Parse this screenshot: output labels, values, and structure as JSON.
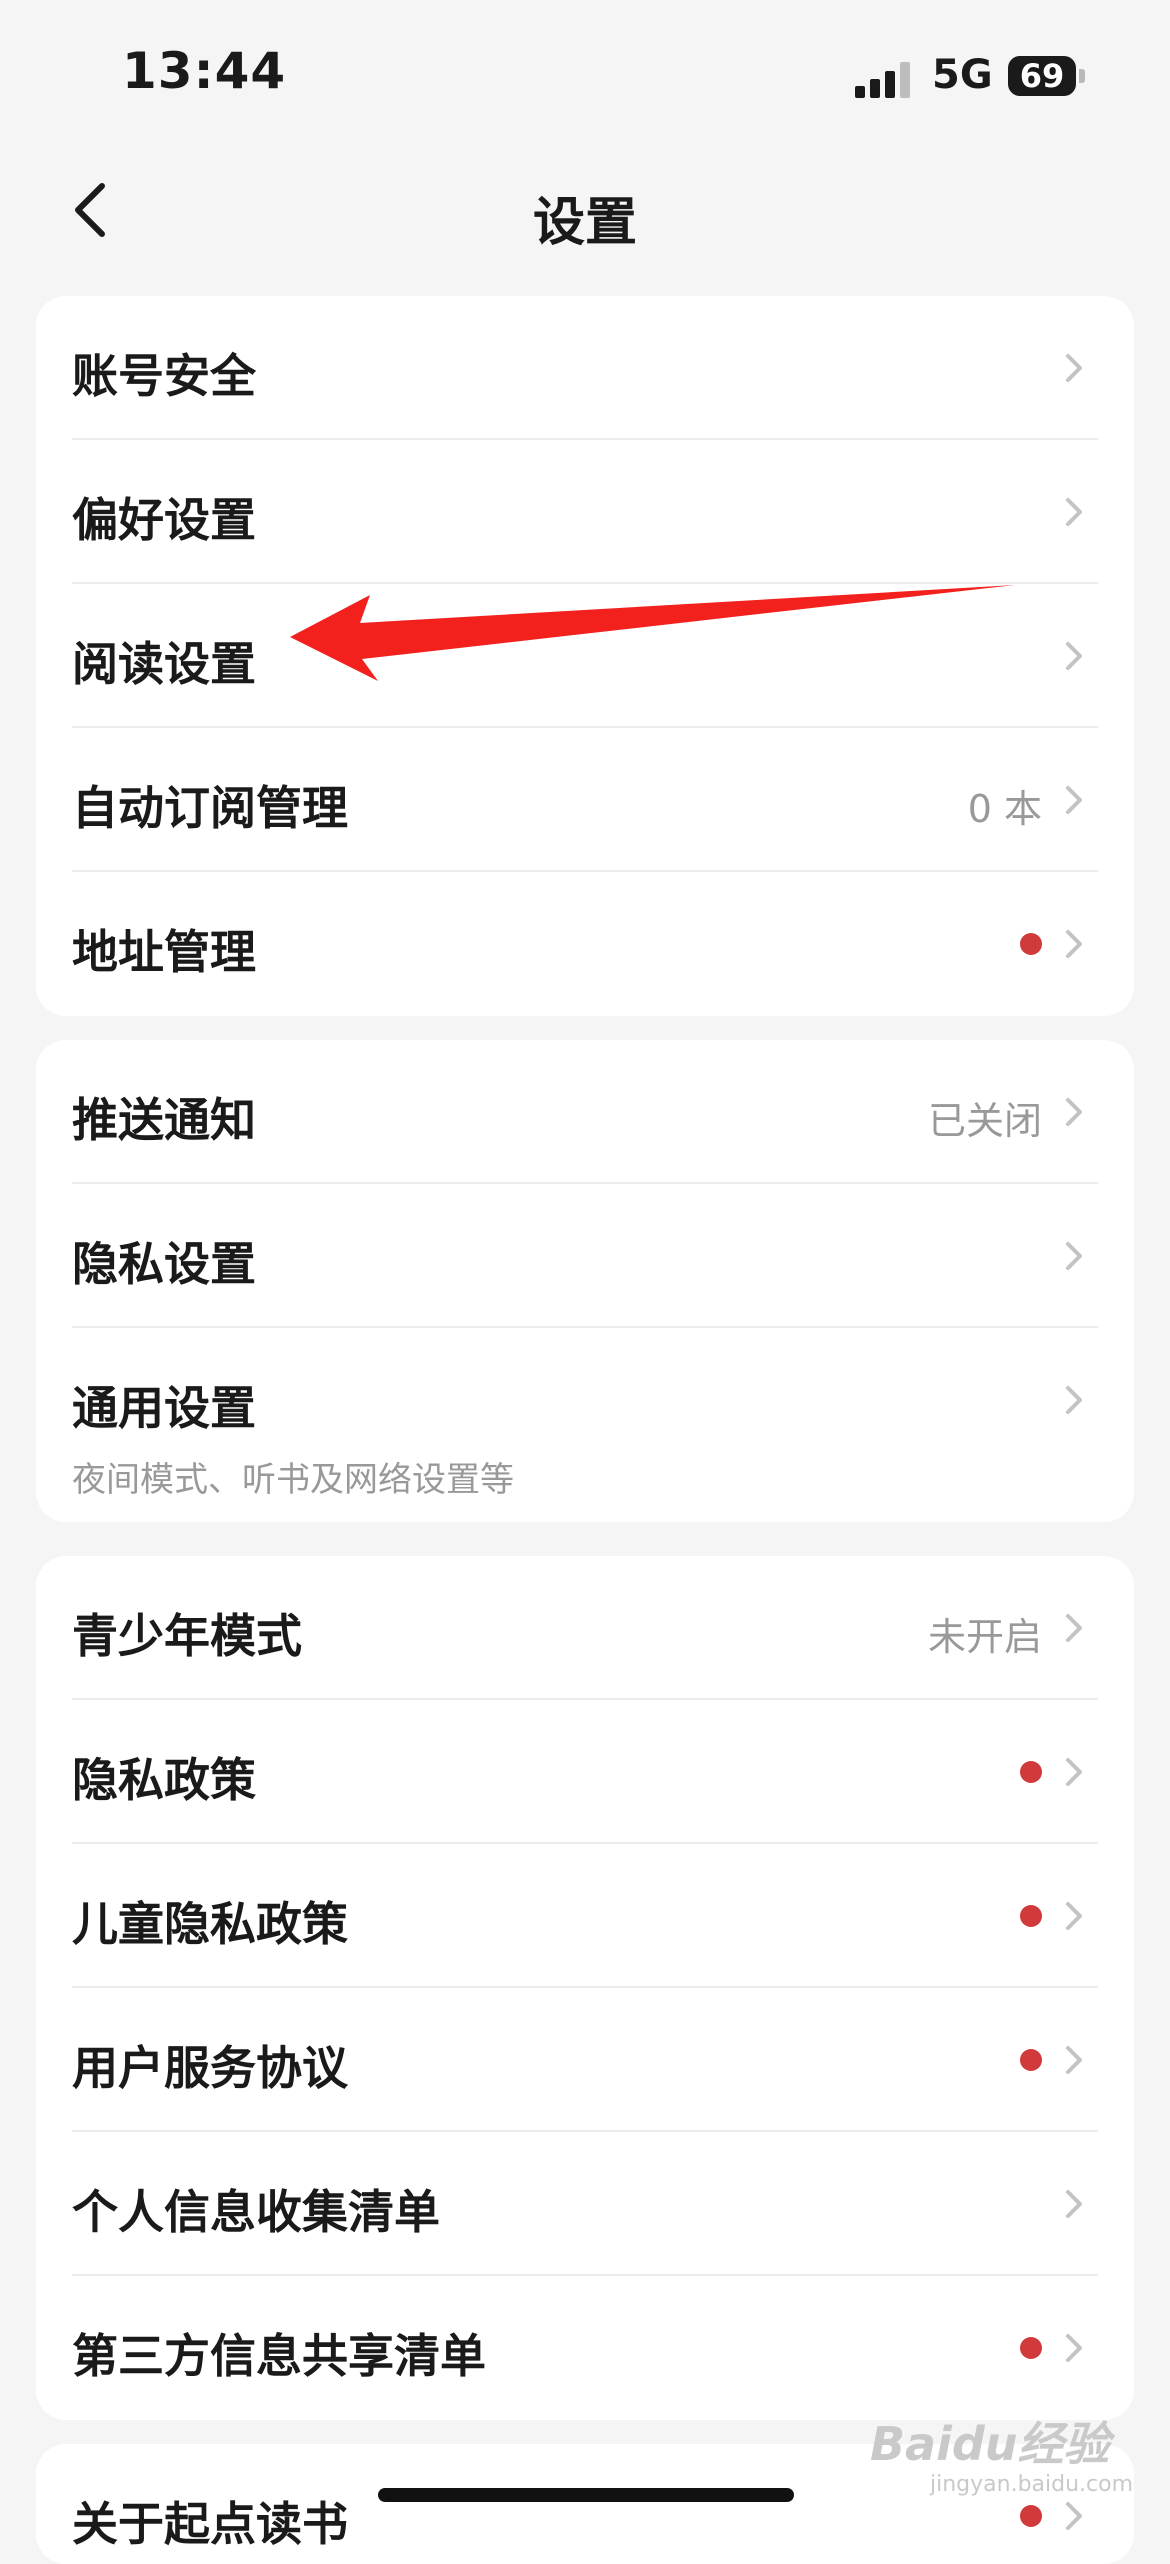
{
  "status_bar": {
    "time": "13:44",
    "network": "5G",
    "battery": "69"
  },
  "nav": {
    "title": "设置"
  },
  "group1": [
    {
      "label": "账号安全",
      "value": "",
      "dot": false
    },
    {
      "label": "偏好设置",
      "value": "",
      "dot": false
    },
    {
      "label": "阅读设置",
      "value": "",
      "dot": false
    },
    {
      "label": "自动订阅管理",
      "value": "0 本",
      "dot": false
    },
    {
      "label": "地址管理",
      "value": "",
      "dot": true
    }
  ],
  "group2": [
    {
      "label": "推送通知",
      "value": "已关闭",
      "dot": false
    },
    {
      "label": "隐私设置",
      "value": "",
      "dot": false
    },
    {
      "label": "通用设置",
      "sub": "夜间模式、听书及网络设置等",
      "dot": false
    }
  ],
  "group3": [
    {
      "label": "青少年模式",
      "value": "未开启",
      "dot": false
    },
    {
      "label": "隐私政策",
      "value": "",
      "dot": true
    },
    {
      "label": "儿童隐私政策",
      "value": "",
      "dot": true
    },
    {
      "label": "用户服务协议",
      "value": "",
      "dot": true
    },
    {
      "label": "个人信息收集清单",
      "value": "",
      "dot": false
    },
    {
      "label": "第三方信息共享清单",
      "value": "",
      "dot": true
    }
  ],
  "group4": [
    {
      "label": "关于起点读书",
      "value": "",
      "dot": true
    }
  ],
  "watermark": {
    "main": "Baidu经验",
    "sub": "jingyan.baidu.com"
  },
  "colors": {
    "background": "#f5f5f5",
    "card": "#ffffff",
    "dot": "#d03a3a",
    "annotation_arrow": "#f2211d"
  }
}
